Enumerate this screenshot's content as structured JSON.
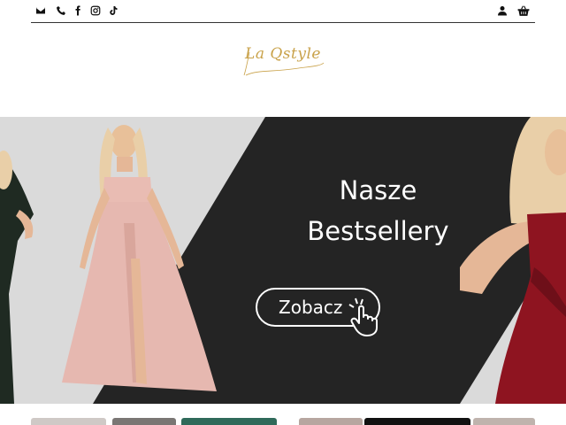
{
  "topbar": {
    "icons_left": [
      "email-icon",
      "phone-icon",
      "facebook-icon",
      "instagram-icon",
      "tiktok-icon"
    ],
    "icons_right": [
      "user-icon",
      "basket-icon"
    ]
  },
  "logo": {
    "text": "La Qstyle",
    "color": "#c9a24a"
  },
  "hero": {
    "title_line1": "Nasze",
    "title_line2": "Bestsellery",
    "cta_label": "Zobacz",
    "colors": {
      "dark_panel": "#242424",
      "light_bg": "#dadada",
      "pink_dress": "#e6b8b0",
      "red_dress": "#8e1420"
    }
  }
}
